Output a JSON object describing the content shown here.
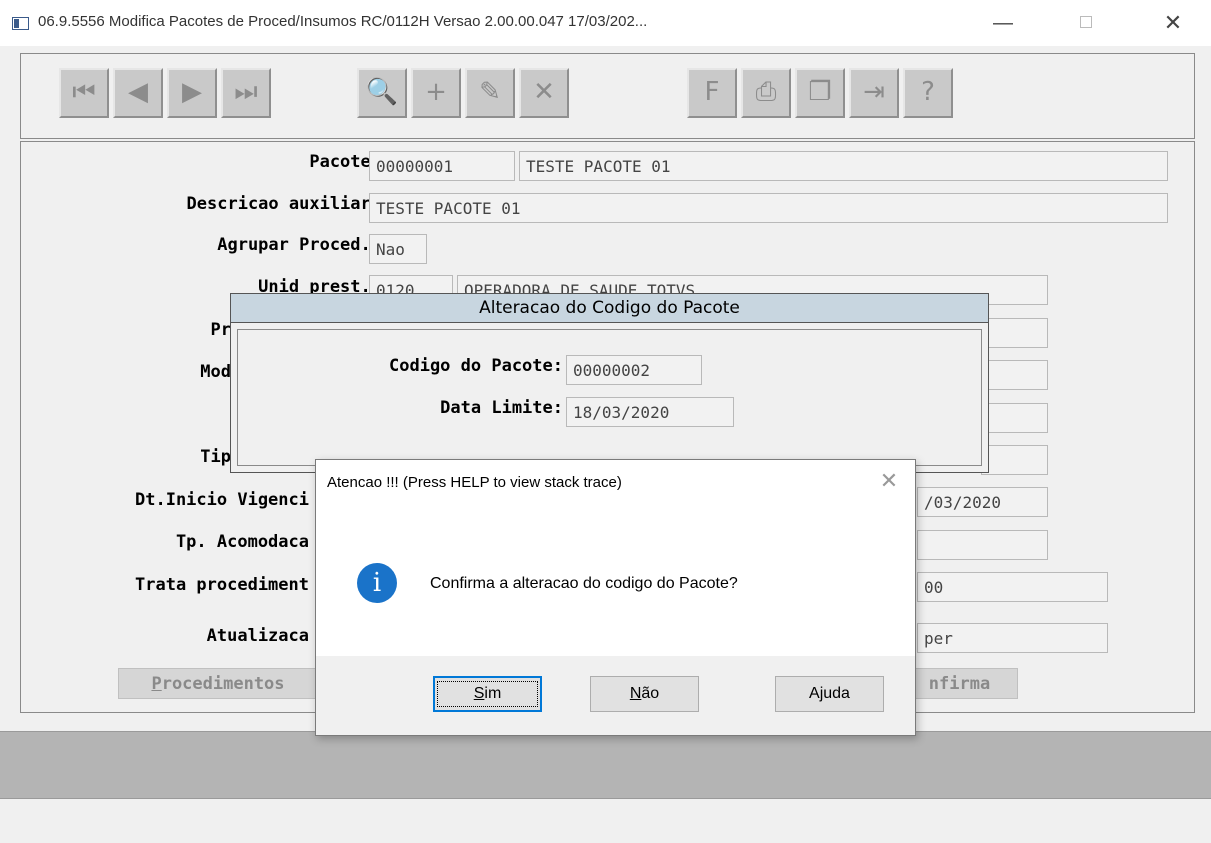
{
  "window": {
    "title": "06.9.5556  Modifica  Pacotes de Proced/Insumos RC/0112H Versao 2.00.00.047 17/03/202...",
    "minimize": "—",
    "close": "✕"
  },
  "toolbar": {
    "buttons": [
      {
        "name": "first-record",
        "glyph": "⏮"
      },
      {
        "name": "prev-record",
        "glyph": "◀"
      },
      {
        "name": "next-record",
        "glyph": "▶"
      },
      {
        "name": "last-record",
        "glyph": "⏭"
      },
      {
        "name": "search",
        "glyph": "🔍"
      },
      {
        "name": "add",
        "glyph": "+"
      },
      {
        "name": "edit",
        "glyph": "✎"
      },
      {
        "name": "delete",
        "glyph": "✕"
      },
      {
        "name": "filter",
        "glyph": "F"
      },
      {
        "name": "print",
        "glyph": "⎙"
      },
      {
        "name": "copy",
        "glyph": "❐"
      },
      {
        "name": "exit",
        "glyph": "⇥"
      },
      {
        "name": "help",
        "glyph": "?"
      }
    ]
  },
  "form": {
    "pacote_label": "Pacote:",
    "pacote_code": "00000001",
    "pacote_desc": "TESTE PACOTE 01",
    "desc_aux_label": "Descricao auxiliar:",
    "desc_aux_value": "TESTE PACOTE 01",
    "agrupar_label": "Agrupar Proced.:",
    "agrupar_value": "Nao",
    "unid_label": "Unid prest.:",
    "unid_code": "0120",
    "unid_desc": "OPERADORA DE SAUDE TOTVS",
    "pr_label": "Pr",
    "mod_label": "Mod",
    "tip_label": "Tip",
    "dt_inicio_label": "Dt.Inicio Vigenci",
    "dt_inicio_value": "/03/2020",
    "acomod_label": "Tp. Acomodaca",
    "trata_label": "Trata procediment",
    "trata_value": "00",
    "atualiz_label": "Atualizaca",
    "atualiz_value": "per",
    "procedimentos_button_first": "P",
    "procedimentos_button_rest": "rocedimentos",
    "confirma_button": "nfirma"
  },
  "code_dialog": {
    "title": "Alteracao do Codigo do Pacote",
    "codigo_label": "Codigo do Pacote:",
    "codigo_value": "00000002",
    "data_label": "Data Limite:",
    "data_value": "18/03/2020"
  },
  "message_box": {
    "title": "Atencao !!! (Press HELP to view stack trace)",
    "close": "✕",
    "icon": "i",
    "message": "Confirma a alteracao do codigo do Pacote?",
    "sim_underline": "S",
    "sim_rest": "im",
    "nao_underline": "N",
    "nao_rest": "ão",
    "ajuda": "Ajuda"
  }
}
